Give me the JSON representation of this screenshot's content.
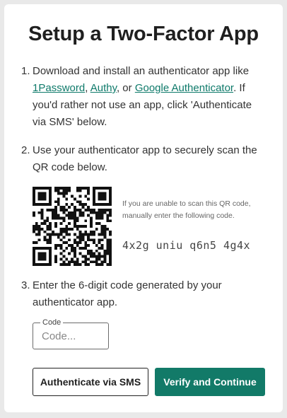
{
  "title": "Setup a Two-Factor App",
  "steps": {
    "one": {
      "num": "1.",
      "pre": "Download and install an authenticator app like ",
      "links": [
        "1Password",
        "Authy",
        "Google Authenticator"
      ],
      "sep1": ", ",
      "sep2": ", or ",
      "post": ". If you'd rather not use an app, click 'Authenticate via SMS' below."
    },
    "two": {
      "num": "2.",
      "text": "Use your authenticator app to securely scan the QR code below."
    },
    "three": {
      "num": "3.",
      "text": "Enter the 6-digit code generated by your authenticator app."
    }
  },
  "qr": {
    "help_text": "If you are unable to scan this QR code, manually enter the following code.",
    "secret": "4x2g uniu q6n5 4g4x"
  },
  "code_field": {
    "label": "Code",
    "placeholder": "Code...",
    "value": ""
  },
  "buttons": {
    "sms": "Authenticate via SMS",
    "verify": "Verify and Continue"
  },
  "colors": {
    "accent": "#127a68",
    "link": "#0e7a6a"
  }
}
